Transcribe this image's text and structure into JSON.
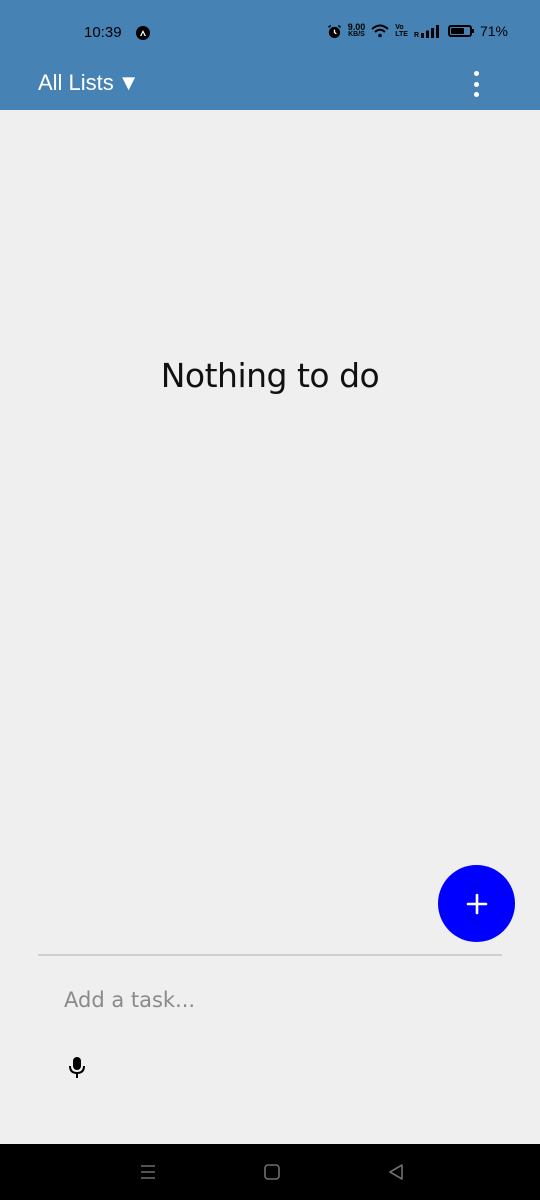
{
  "status_bar": {
    "time": "10:39",
    "net_speed_value": "9.00",
    "net_speed_unit": "KB/S",
    "volte_top": "Vo",
    "volte_bottom": "LTE",
    "signal_label": "R",
    "battery_percent": "71%",
    "battery_level": 0.71,
    "icons": [
      "notification-a-icon",
      "alarm-icon",
      "wifi-icon",
      "signal-icon",
      "battery-icon"
    ]
  },
  "app_bar": {
    "list_selector_label": "All Lists",
    "dropdown_glyph": "▼",
    "background_color": "#4682b4",
    "overflow_icon": "more-vert-icon"
  },
  "main": {
    "empty_message": "Nothing to do"
  },
  "fab": {
    "icon": "plus-icon",
    "color": "#0000ff"
  },
  "task_entry": {
    "placeholder": "Add a task...",
    "value": "",
    "mic_icon": "microphone-icon"
  },
  "nav_bar": {
    "buttons": [
      "recent-apps-icon",
      "home-icon",
      "back-icon"
    ]
  }
}
